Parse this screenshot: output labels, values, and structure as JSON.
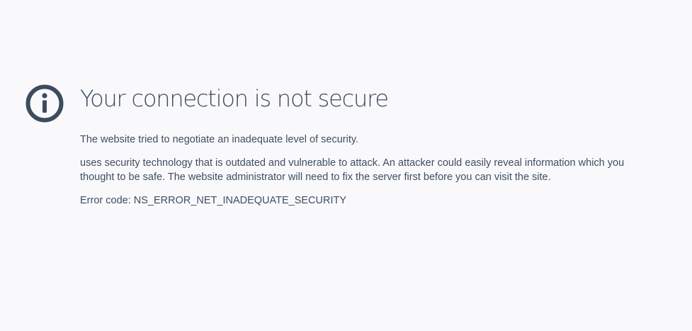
{
  "colors": {
    "background": "#f9f9fb",
    "text": "#3d4b5f",
    "icon": "#3d4b5f"
  },
  "icon": {
    "name": "info-icon"
  },
  "error": {
    "title": "Your connection is not secure",
    "short_description": "The website tried to negotiate an inadequate level of security.",
    "long_description": "uses security technology that is outdated and vulnerable to attack. An attacker could easily reveal information which you thought to be safe. The website administrator will need to fix the server first before you can visit the site.",
    "code_label": "Error code: NS_ERROR_NET_INADEQUATE_SECURITY"
  }
}
